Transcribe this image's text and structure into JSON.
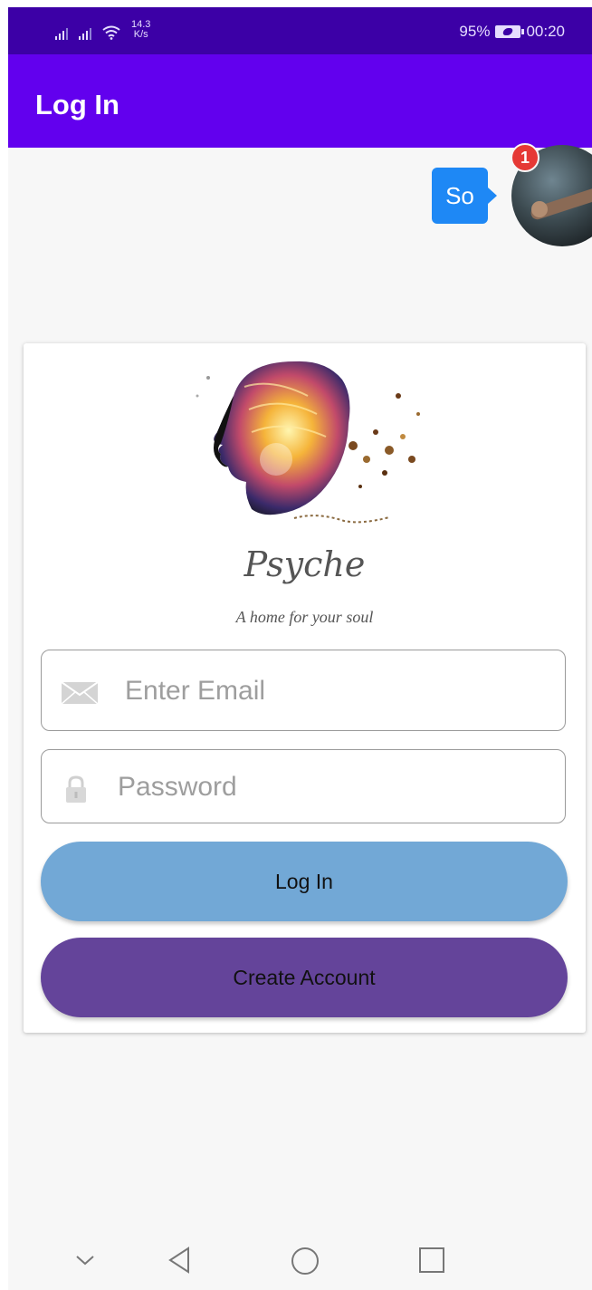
{
  "status_bar": {
    "network_speed_value": "14.3",
    "network_speed_unit": "K/s",
    "battery_percent": "95%",
    "time": "00:20"
  },
  "app_bar": {
    "title": "Log In"
  },
  "chat_head": {
    "bubble_text": "So",
    "badge_count": "1"
  },
  "card": {
    "brand_name": "Psyche",
    "tagline": "A home for your soul",
    "email_placeholder": "Enter Email",
    "password_placeholder": "Password",
    "login_label": "Log In",
    "create_account_label": "Create Account"
  },
  "colors": {
    "status_bar": "#3c00a6",
    "app_bar": "#6200ee",
    "login_button": "#72a8d6",
    "create_button": "#64449a",
    "chat_bubble": "#1e88f5",
    "badge": "#e53935"
  },
  "icons": {
    "email": "envelope-icon",
    "password": "lock-icon",
    "nav": [
      "chevron-down-icon",
      "back-triangle-icon",
      "home-circle-icon",
      "recents-square-icon"
    ]
  }
}
